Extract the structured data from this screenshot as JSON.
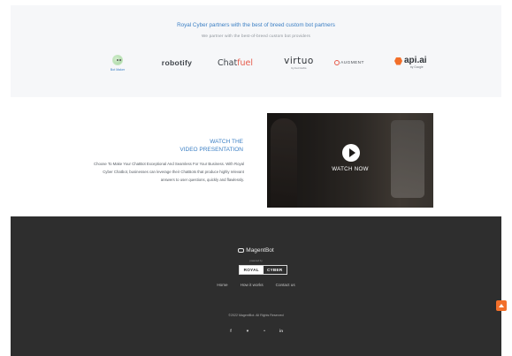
{
  "partners": {
    "title": "Royal Cyber partners with the best of breed custom bot partners",
    "subtitle": "We partner with the best-of-breed custom bot providers",
    "logos": {
      "botmaker": "Bot Maker",
      "robotify": "robotify",
      "chatfuel_main": "Chat",
      "chatfuel_accent": "fuel",
      "virtuo_main": "virtuo",
      "virtuo_sub": "by bot Corbs",
      "augment": "AUGMENT",
      "apiai_main": "api.ai",
      "apiai_sub": "by Google"
    }
  },
  "video_section": {
    "heading_line1": "WATCH THE",
    "heading_line2": "VIDEO PRESENTATION",
    "body": "Choose To Make Your ChatBot Exceptional And Seamless For Your Business. With Royal Cyber Chatbot, businesses can leverage their ChatBots that produce highly relevant answers to user questions, quickly and flawlessly.",
    "watch_label": "WATCH NOW"
  },
  "footer": {
    "brand": "MagentBot",
    "powered_by": "powered by",
    "rc_left": "ROYAL",
    "rc_right": "CYBER",
    "nav": {
      "home": "Home",
      "how_it_works": "How it works",
      "contact": "Contact us"
    },
    "copyright": "©2022 MagentBot. All Rights Reserved",
    "social": {
      "facebook": "f",
      "twitter": "♥",
      "google": "•",
      "linkedin": "in"
    }
  },
  "colors": {
    "accent_blue": "#3b7fc4",
    "footer_bg": "#2e2e2e",
    "scroll_top": "#f26f2a"
  }
}
